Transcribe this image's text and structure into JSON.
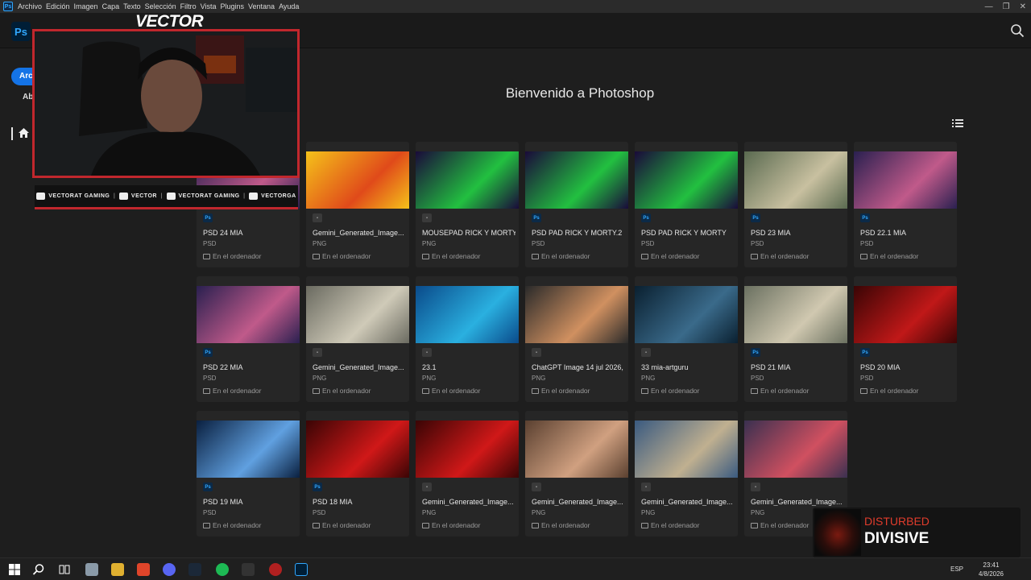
{
  "menu": {
    "items": [
      "Archivo",
      "Edición",
      "Imagen",
      "Capa",
      "Texto",
      "Selección",
      "Filtro",
      "Vista",
      "Plugins",
      "Ventana",
      "Ayuda"
    ]
  },
  "header": {
    "logo": "Ps"
  },
  "sidebar": {
    "new_label": "Archivo nuevo",
    "open_label": "Abrir"
  },
  "main": {
    "welcome": "Bienvenido a Photoshop"
  },
  "files": [
    {
      "name": "PSD 24 MIA",
      "type": "PSD",
      "location": "En el ordenador"
    },
    {
      "name": "Gemini_Generated_Image...",
      "type": "PNG",
      "location": "En el ordenador"
    },
    {
      "name": "MOUSEPAD RICK Y MORTY...",
      "type": "PNG",
      "location": "En el ordenador"
    },
    {
      "name": "PSD PAD RICK Y MORTY.2",
      "type": "PSD",
      "location": "En el ordenador"
    },
    {
      "name": "PSD PAD RICK Y MORTY",
      "type": "PSD",
      "location": "En el ordenador"
    },
    {
      "name": "PSD 23 MIA",
      "type": "PSD",
      "location": "En el ordenador"
    },
    {
      "name": "PSD 22.1 MIA",
      "type": "PSD",
      "location": "En el ordenador"
    },
    {
      "name": "PSD 22 MIA",
      "type": "PSD",
      "location": "En el ordenador"
    },
    {
      "name": "Gemini_Generated_Image...",
      "type": "PNG",
      "location": "En el ordenador"
    },
    {
      "name": "23.1",
      "type": "PNG",
      "location": "En el ordenador"
    },
    {
      "name": "ChatGPT Image 14 jul 2026, ...",
      "type": "PNG",
      "location": "En el ordenador"
    },
    {
      "name": "33 mia-artguru",
      "type": "PNG",
      "location": "En el ordenador"
    },
    {
      "name": "PSD 21 MIA",
      "type": "PSD",
      "location": "En el ordenador"
    },
    {
      "name": "PSD 20 MIA",
      "type": "PSD",
      "location": "En el ordenador"
    },
    {
      "name": "PSD 19 MIA",
      "type": "PSD",
      "location": "En el ordenador"
    },
    {
      "name": "PSD 18 MIA",
      "type": "PSD",
      "location": "En el ordenador"
    },
    {
      "name": "Gemini_Generated_Image...",
      "type": "PNG",
      "location": "En el ordenador"
    },
    {
      "name": "Gemini_Generated_Image...",
      "type": "PNG",
      "location": "En el ordenador"
    },
    {
      "name": "Gemini_Generated_Image...",
      "type": "PNG",
      "location": "En el ordenador"
    },
    {
      "name": "Gemini_Generated_Image...",
      "type": "PNG",
      "location": "En el ordenador"
    }
  ],
  "overlay": {
    "streamer": "VECTOR",
    "social": [
      "VECTORAT GAMING",
      "VECTOR",
      "VECTORAT GAMING",
      "VECTORGA"
    ]
  },
  "now_playing": {
    "artist": "DISTURBED",
    "title": "DIVISIVE"
  },
  "taskbar": {
    "lang": "ESP",
    "time": "23:41",
    "date": "4/8/2026"
  },
  "colors": {
    "accent": "#1473e6",
    "ps_blue": "#31a8ff",
    "overlay_red": "#c1272d"
  }
}
